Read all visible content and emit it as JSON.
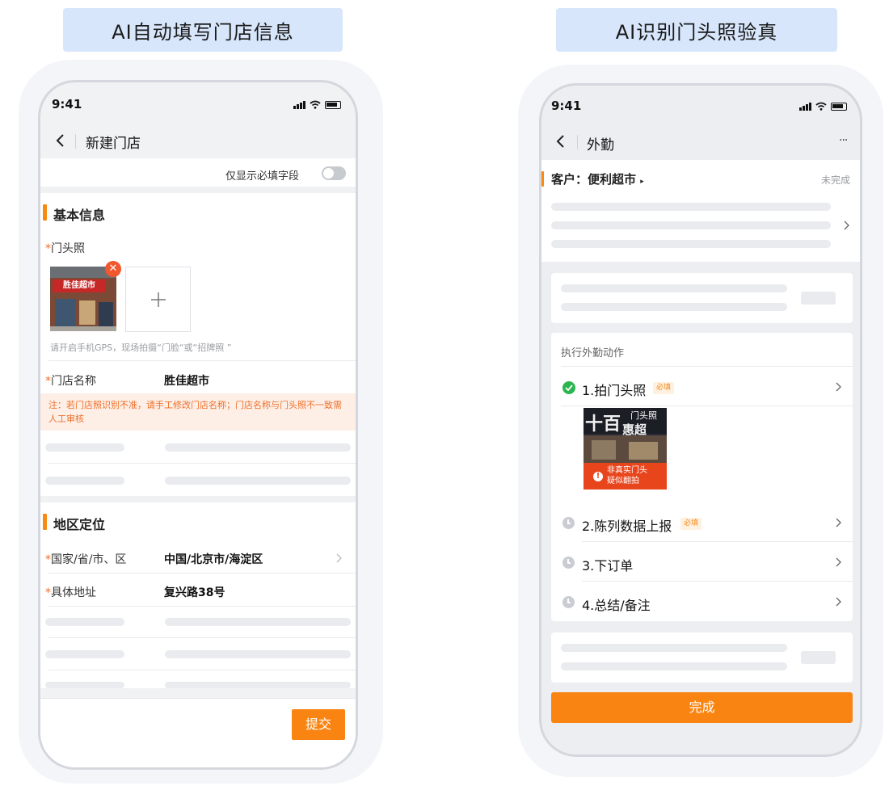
{
  "captions": {
    "left": "AI自动填写门店信息",
    "right": "AI识别门头照验真"
  },
  "left": {
    "status_time": "9:41",
    "nav_title": "新建门店",
    "toggle_label": "仅显示必填字段",
    "section_basic": "基本信息",
    "photo_label": "门头照",
    "required_mark": "*",
    "photo_hint": "请开启手机GPS，现场拍摄“门脸“或“招牌照 ”",
    "sign_text": "胜佳超市",
    "store_name_label": "门店名称",
    "store_name_value": "胜佳超市",
    "warning": "注：若门店照识别不准，请手工修改门店名称；门店名称与门头照不一致需人工审核",
    "section_region": "地区定位",
    "region_label": "国家/省/市、区",
    "region_value": "中国/北京市/海淀区",
    "address_label": "具体地址",
    "address_value": "复兴路38号",
    "submit_label": "提交"
  },
  "right": {
    "status_time": "9:41",
    "nav_title": "外勤",
    "more": "···",
    "customer": "客户：便利超市",
    "customer_status": "未完成",
    "actions_title": "执行外勤动作",
    "steps": [
      {
        "label": "1.拍门头照",
        "tag": "必填",
        "state": "done"
      },
      {
        "label": "2.陈列数据上报",
        "tag": "必填",
        "state": "pending"
      },
      {
        "label": "3.下订单",
        "tag": "",
        "state": "pending"
      },
      {
        "label": "4.总结/备注",
        "tag": "",
        "state": "pending"
      }
    ],
    "photo_sign": "十百",
    "photo_sign_2": "惠超",
    "photo_overlay": "门头照",
    "alert_line1": "非真实门头",
    "alert_line2": "疑似翻拍",
    "finish_label": "完成"
  },
  "colors": {
    "accent": "#f88a14",
    "button": "#fa8411",
    "caption_bg": "#d8e6fb",
    "success": "#2cb54e",
    "alert": "#e8451c"
  }
}
